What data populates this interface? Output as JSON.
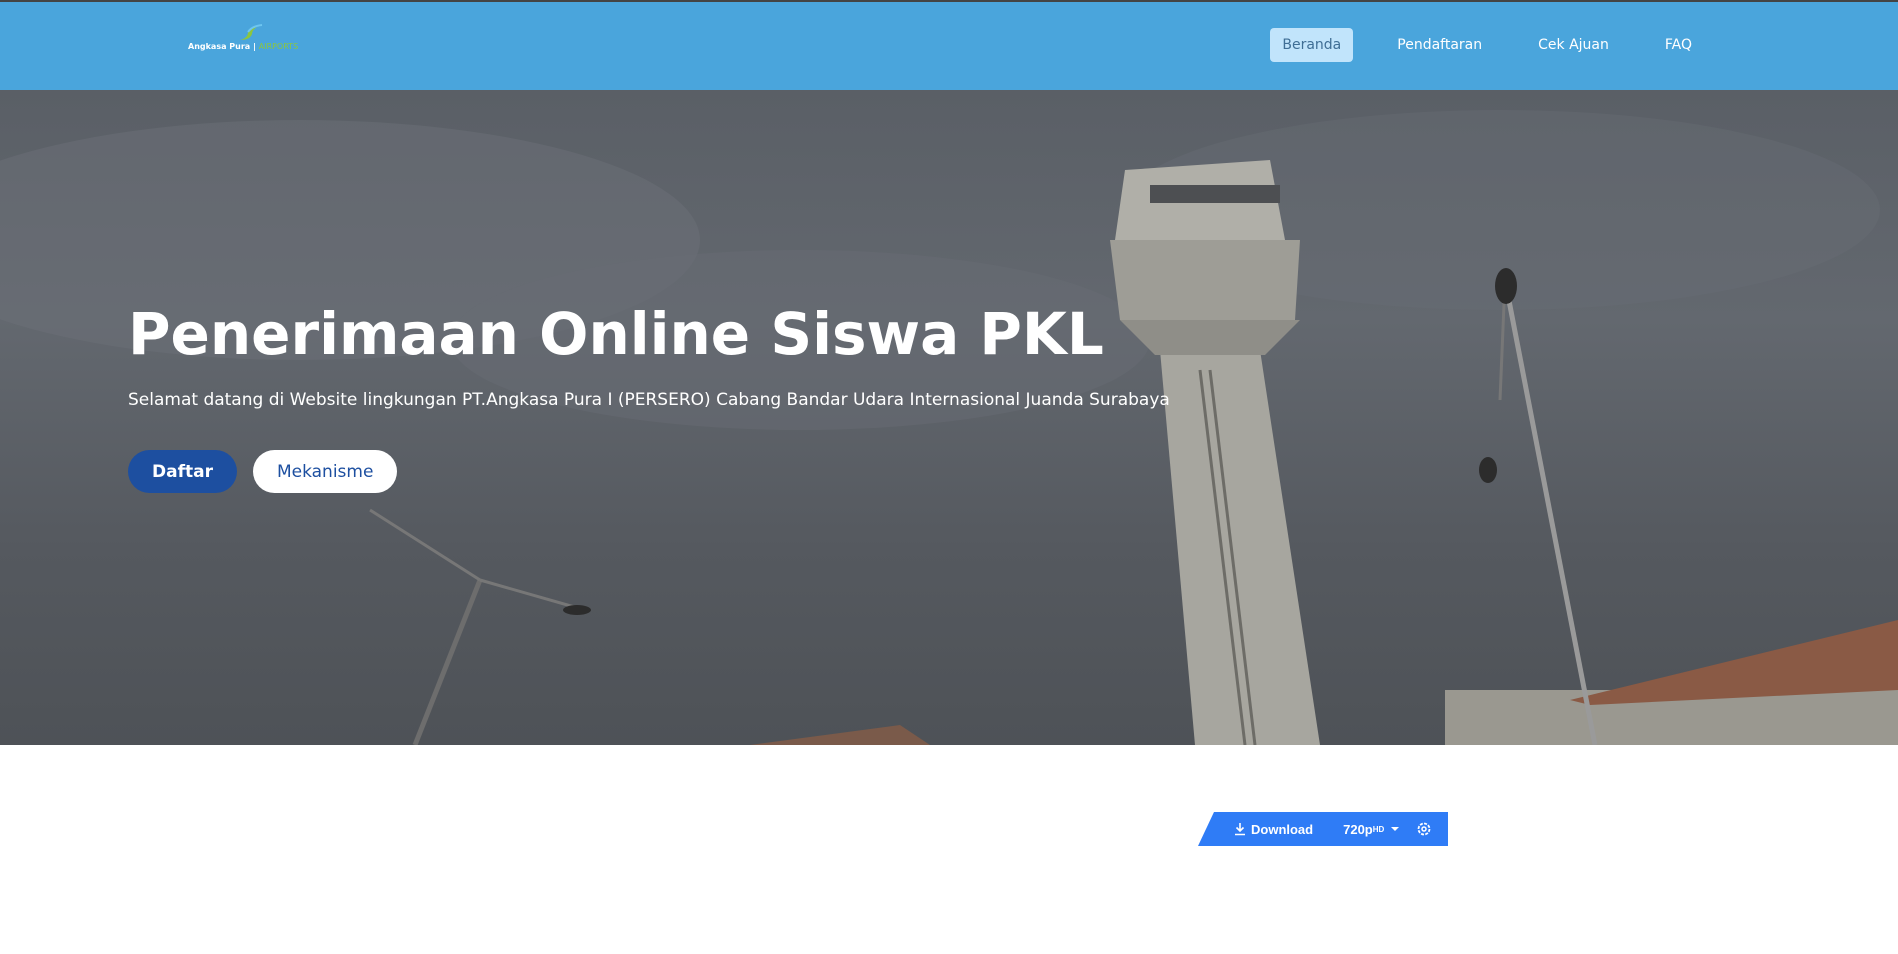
{
  "brand": {
    "name": "Angkasa Pura",
    "suffix": "AIRPORTS"
  },
  "nav": {
    "items": [
      {
        "label": "Beranda",
        "active": true
      },
      {
        "label": "Pendaftaran"
      },
      {
        "label": "Cek Ajuan"
      },
      {
        "label": "FAQ"
      }
    ]
  },
  "hero": {
    "title": "Penerimaan Online Siswa PKL",
    "subtitle": "Selamat datang di Website lingkungan PT.Angkasa Pura I (PERSERO) Cabang Bandar Udara Internasional Juanda Surabaya",
    "primary_button": "Daftar",
    "secondary_button": "Mekanisme"
  },
  "video_toolbar": {
    "download_label": "Download",
    "quality": "720p",
    "quality_badge": "HD",
    "icons": [
      "download-icon",
      "caret-down-icon",
      "gear-icon"
    ]
  },
  "colors": {
    "navbar": "#4aa5dc",
    "primary": "#1d4fa0",
    "download_bar": "#2f7cf6"
  }
}
